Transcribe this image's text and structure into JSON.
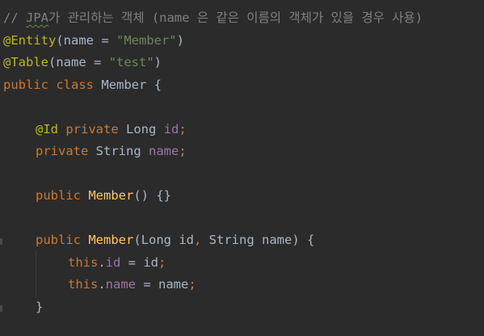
{
  "editor": {
    "comment": {
      "slashes": "// ",
      "jpa": "JPA",
      "rest": "가 관리하는 객체 (name 은 같은 이름의 객체가 있을 경우 사용)"
    },
    "entity": {
      "annotation": "@Entity",
      "open": "(name = ",
      "value": "\"Member\"",
      "close": ")"
    },
    "table": {
      "annotation": "@Table",
      "open": "(name = ",
      "value": "\"test\"",
      "close": ")"
    },
    "class_decl": {
      "kw_public": "public",
      "kw_class": "class",
      "name": "Member",
      "brace": "{"
    },
    "id_field": {
      "annotation": "@Id",
      "kw_private": "private",
      "type": "Long",
      "name": "id",
      "semi": ";"
    },
    "name_field": {
      "kw_private": "private",
      "type": "String",
      "name": "name",
      "semi": ";"
    },
    "default_ctor": {
      "kw_public": "public",
      "name": "Member",
      "rest": "() {}"
    },
    "param_ctor": {
      "kw_public": "public",
      "name": "Member",
      "params_a": "(Long id",
      "comma": ",",
      "params_b": " String name) {"
    },
    "assign_id": {
      "kw_this": "this",
      "dot": ".",
      "field": "id",
      "rest": " = id",
      "semi": ";"
    },
    "assign_name": {
      "kw_this": "this",
      "dot": ".",
      "field": "name",
      "rest": " = name",
      "semi": ";"
    },
    "close_ctor": "}"
  },
  "colors": {
    "background": "#2b2b2b",
    "comment": "#808080",
    "annotation": "#bbb529",
    "string": "#6a8759",
    "keyword": "#cc7832",
    "field": "#9876aa",
    "method": "#ffc66d",
    "text": "#a9b7c6"
  }
}
